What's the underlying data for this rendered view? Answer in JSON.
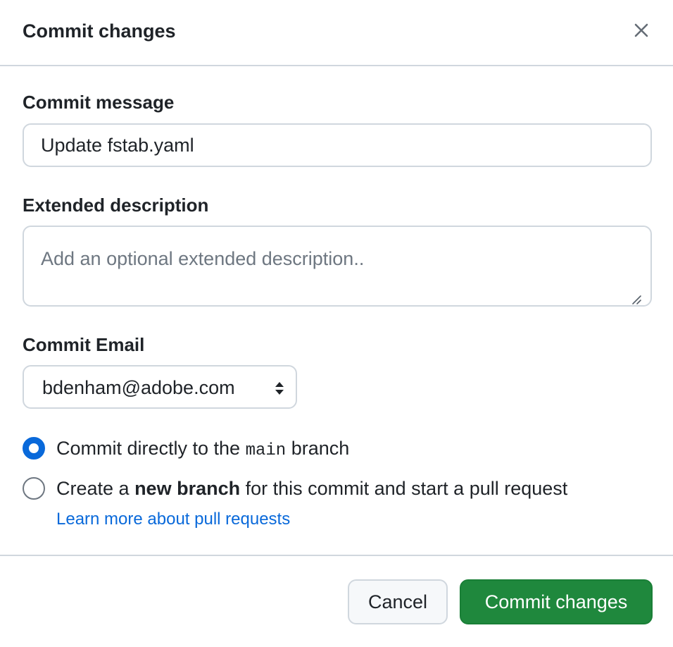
{
  "dialog": {
    "title": "Commit changes",
    "close_icon": "close-icon"
  },
  "commit_message": {
    "label": "Commit message",
    "value": "Update fstab.yaml"
  },
  "extended_description": {
    "label": "Extended description",
    "placeholder": "Add an optional extended description.."
  },
  "commit_email": {
    "label": "Commit Email",
    "selected": "bdenham@adobe.com"
  },
  "branch_options": {
    "direct": {
      "checked": true,
      "text_before": "Commit directly to the ",
      "branch_name": "main",
      "text_after": " branch"
    },
    "new_branch": {
      "checked": false,
      "text_before": "Create a ",
      "bold_text": "new branch",
      "text_after": " for this commit and start a pull request"
    },
    "learn_more_link": "Learn more about pull requests"
  },
  "buttons": {
    "cancel_label": "Cancel",
    "commit_label": "Commit changes"
  },
  "colors": {
    "primary_button": "#1f883d",
    "accent": "#0969da",
    "border": "#d0d7de"
  }
}
